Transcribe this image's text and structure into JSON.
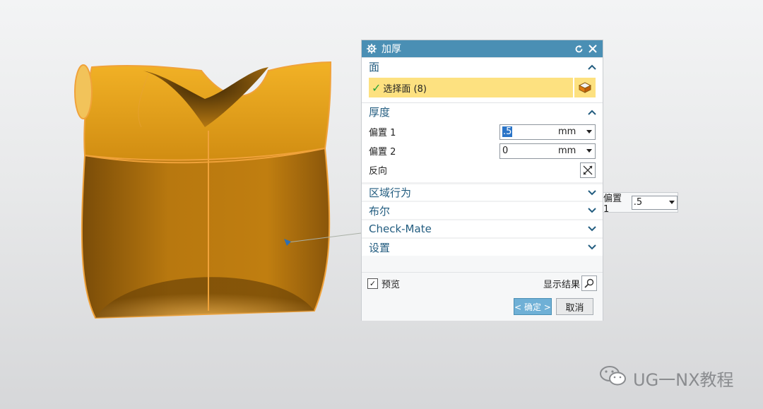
{
  "dialog": {
    "title": "加厚",
    "sections": {
      "face": {
        "label": "面",
        "select_text": "选择面 (8)"
      },
      "thickness": {
        "label": "厚度",
        "offset1_label": "偏置 1",
        "offset1_value": ".5",
        "offset1_unit": "mm",
        "offset2_label": "偏置 2",
        "offset2_value": "0",
        "offset2_unit": "mm",
        "reverse_label": "反向"
      },
      "region": {
        "label": "区域行为"
      },
      "boolean": {
        "label": "布尔"
      },
      "checkmate": {
        "label": "Check-Mate"
      },
      "settings": {
        "label": "设置"
      }
    },
    "preview_label": "预览",
    "show_result_label": "显示结果",
    "ok_label": "< 确定 >",
    "cancel_label": "取消"
  },
  "floating_input": {
    "label": "偏置 1",
    "value": ".5"
  },
  "watermark": "UG一NX教程",
  "colors": {
    "titlebar": "#4a8fb4",
    "section_text": "#235d80",
    "selection_highlight": "#fde180",
    "model_orange": "#d38a10"
  },
  "icons": [
    "gear-icon",
    "reset-icon",
    "close-icon",
    "chevron-up-icon",
    "chevron-down-icon",
    "checkmark-icon",
    "face-select-icon",
    "reverse-direction-icon",
    "magnifier-icon",
    "dropdown-arrow-icon",
    "wechat-icon"
  ]
}
